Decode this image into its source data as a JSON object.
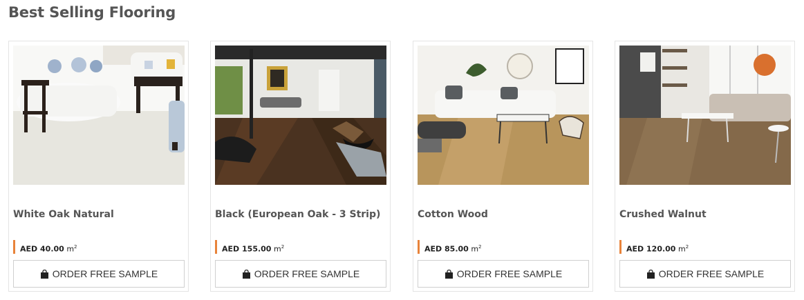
{
  "section": {
    "title": "Best Selling Flooring"
  },
  "products": [
    {
      "name": "White Oak Natural",
      "currency": "AED",
      "price": "40.00",
      "unit": "m",
      "unit_exp": "2",
      "button": "ORDER FREE SAMPLE",
      "theme": "white"
    },
    {
      "name": "Black (European Oak - 3 Strip)",
      "currency": "AED",
      "price": "155.00",
      "unit": "m",
      "unit_exp": "2",
      "button": "ORDER FREE SAMPLE",
      "theme": "dark"
    },
    {
      "name": "Cotton Wood",
      "currency": "AED",
      "price": "85.00",
      "unit": "m",
      "unit_exp": "2",
      "button": "ORDER FREE SAMPLE",
      "theme": "light"
    },
    {
      "name": "Crushed Walnut",
      "currency": "AED",
      "price": "120.00",
      "unit": "m",
      "unit_exp": "2",
      "button": "ORDER FREE SAMPLE",
      "theme": "walnut"
    }
  ],
  "colors": {
    "accent": "#e8833a",
    "text": "#555555",
    "border": "#e4e4e4"
  },
  "icons": {
    "button_icon": "shopping-bag-icon"
  }
}
